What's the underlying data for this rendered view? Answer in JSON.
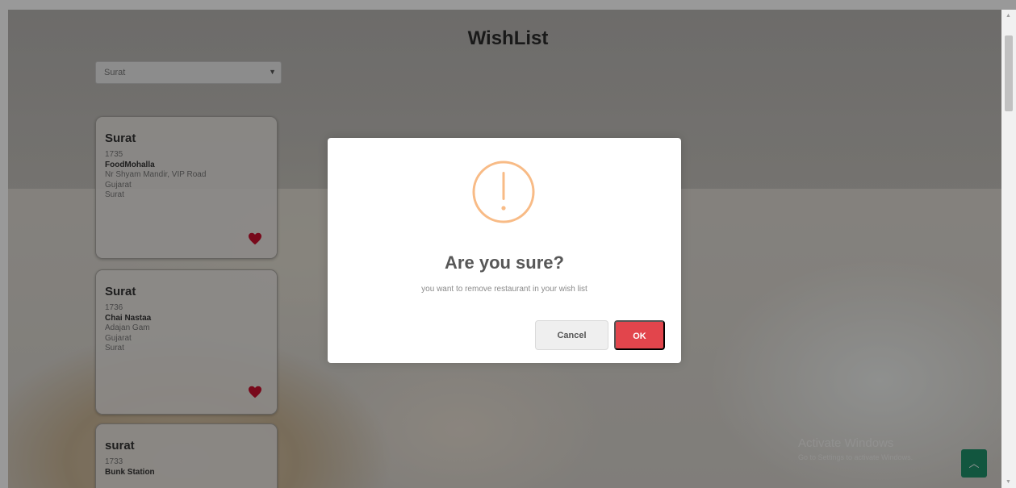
{
  "page": {
    "title": "WishList",
    "city_select": {
      "selected": "Surat"
    }
  },
  "restaurants": [
    {
      "city": "Surat",
      "id": "1735",
      "name": "FoodMohalla",
      "address": "Nr Shyam Mandir, VIP Road",
      "state": "Gujarat",
      "area": "Surat"
    },
    {
      "city": "Surat",
      "id": "1736",
      "name": "Chai Nastaa",
      "address": "Adajan Gam",
      "state": "Gujarat",
      "area": "Surat"
    },
    {
      "city": "surat",
      "id": "1733",
      "name": "Bunk Station"
    }
  ],
  "dialog": {
    "title": "Are you sure?",
    "text": "you want to remove restaurant in your wish list",
    "cancel_label": "Cancel",
    "ok_label": "OK"
  },
  "watermark": {
    "title": "Activate Windows",
    "subtitle": "Go to Settings to activate Windows."
  },
  "icons": {
    "heart": "heart-icon",
    "warning": "exclamation-circle-icon",
    "scroll_top": "chevron-up-icon",
    "select_arrow": "chevron-down-icon"
  },
  "colors": {
    "ok_button": "#e2454c",
    "warning_icon": "#f8bb86",
    "heart": "#c8102e",
    "scroll_top_button": "#1f8f6a"
  }
}
